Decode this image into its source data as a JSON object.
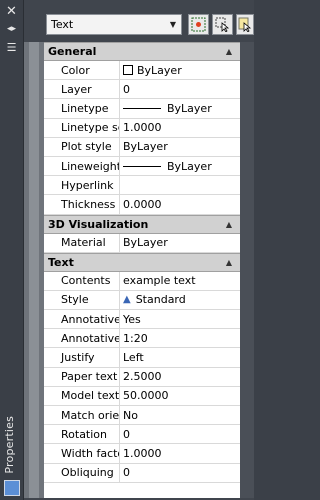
{
  "toolbar": {
    "selector_value": "Text",
    "buttons": [
      "quick-select-icon",
      "select-objects-icon",
      "toggle-pickadd-icon"
    ]
  },
  "strip": {
    "close": "✕",
    "autohide": "◂▸",
    "menu": "☰",
    "title": "Properties"
  },
  "sections": [
    {
      "title": "General",
      "rows": [
        {
          "name": "Color",
          "value": "ByLayer",
          "kind": "color"
        },
        {
          "name": "Layer",
          "value": "0"
        },
        {
          "name": "Linetype",
          "value": "ByLayer",
          "kind": "line"
        },
        {
          "name": "Linetype sc...",
          "value": "1.0000"
        },
        {
          "name": "Plot style",
          "value": "ByLayer"
        },
        {
          "name": "Lineweight",
          "value": "ByLayer",
          "kind": "line"
        },
        {
          "name": "Hyperlink",
          "value": ""
        },
        {
          "name": "Thickness",
          "value": "0.0000"
        }
      ]
    },
    {
      "title": "3D Visualization",
      "rows": [
        {
          "name": "Material",
          "value": "ByLayer"
        }
      ]
    },
    {
      "title": "Text",
      "rows": [
        {
          "name": "Contents",
          "value": "example text"
        },
        {
          "name": "Style",
          "value": "Standard",
          "kind": "style"
        },
        {
          "name": "Annotative",
          "value": "Yes"
        },
        {
          "name": "Annotative ...",
          "value": "1:20"
        },
        {
          "name": "Justify",
          "value": "Left"
        },
        {
          "name": "Paper text h...",
          "value": "2.5000"
        },
        {
          "name": "Model text ...",
          "value": "50.0000"
        },
        {
          "name": "Match orien...",
          "value": "No"
        },
        {
          "name": "Rotation",
          "value": "0"
        },
        {
          "name": "Width factor",
          "value": "1.0000"
        },
        {
          "name": "Obliquing",
          "value": "0"
        }
      ]
    }
  ]
}
